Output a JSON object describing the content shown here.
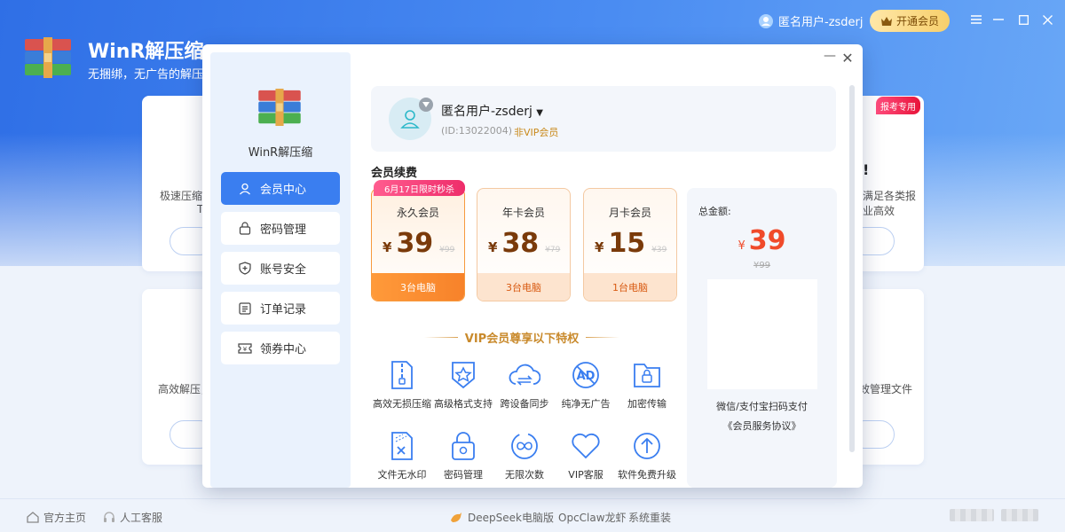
{
  "app": {
    "title": "WinR解压缩",
    "slogan": "无捆绑，无广告的解压缩软件",
    "username": "匿名用户-zsderj",
    "vip_button": "开通会员"
  },
  "background_cards": {
    "card1_text": "极速压缩",
    "card1_text2": "T",
    "card2_text": "高效解压，",
    "card3_heading": "!",
    "card3_text": "满足各类报",
    "card3_text2": "业高效",
    "card4_text": "效管理文件",
    "tag": "报考专用"
  },
  "footer": {
    "home": "官方主页",
    "service": "人工客服",
    "deepseek": "DeepSeek电脑版",
    "opcclaw": "OpcClaw龙虾",
    "reinstall": "系统重装"
  },
  "dialog": {
    "app_name": "WinR解压缩",
    "nav": [
      {
        "label": "会员中心",
        "icon": "user-icon"
      },
      {
        "label": "密码管理",
        "icon": "lock-icon"
      },
      {
        "label": "账号安全",
        "icon": "shield-icon"
      },
      {
        "label": "订单记录",
        "icon": "list-icon"
      },
      {
        "label": "领券中心",
        "icon": "coupon-icon"
      }
    ],
    "user": {
      "name": "匿名用户-zsderj",
      "id": "(ID:13022004)",
      "vip_status": "非VIP会员"
    },
    "renew_title": "会员续费",
    "flash_tag": "6月17日限时秒杀",
    "plans": [
      {
        "name": "永久会员",
        "currency": "¥",
        "price": "39",
        "original": "¥99",
        "devices": "3台电脑",
        "selected": true
      },
      {
        "name": "年卡会员",
        "currency": "¥",
        "price": "38",
        "original": "¥79",
        "devices": "3台电脑",
        "selected": false
      },
      {
        "name": "月卡会员",
        "currency": "¥",
        "price": "15",
        "original": "¥39",
        "devices": "1台电脑",
        "selected": false
      }
    ],
    "total": {
      "label": "总金额:",
      "currency": "¥",
      "amount": "39",
      "original": "¥99",
      "pay_text": "微信/支付宝扫码支付",
      "agreement": "《会员服务协议》"
    },
    "privileges_title": "VIP会员尊享以下特权",
    "features": [
      {
        "label": "高效无损压缩",
        "icon": "zip-file-icon"
      },
      {
        "label": "高级格式支持",
        "icon": "star-badge-icon"
      },
      {
        "label": "跨设备同步",
        "icon": "cloud-sync-icon"
      },
      {
        "label": "纯净无广告",
        "icon": "no-ad-icon"
      },
      {
        "label": "加密传输",
        "icon": "encrypted-folder-icon"
      },
      {
        "label": "文件无水印",
        "icon": "no-watermark-icon"
      },
      {
        "label": "密码管理",
        "icon": "password-lock-icon"
      },
      {
        "label": "无限次数",
        "icon": "infinity-icon"
      },
      {
        "label": "VIP客服",
        "icon": "heart-icon"
      },
      {
        "label": "软件免费升级",
        "icon": "upgrade-icon"
      }
    ]
  },
  "colors": {
    "accent": "#3a7ef0",
    "price": "#f04a2a",
    "gold": "#c98a2c",
    "orange": "#f7822a"
  }
}
